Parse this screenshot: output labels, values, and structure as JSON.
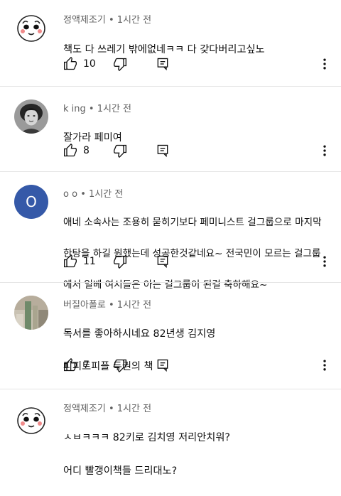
{
  "comments": [
    {
      "author": "정액제조기",
      "time": "1시간 전",
      "lines": [
        "책도 다 쓰레기 밖에없네ㅋㅋ 다 갖다버리고싶노"
      ],
      "likes": "10",
      "avatar": "cartoon"
    },
    {
      "author": "k ing",
      "time": "1시간 전",
      "lines": [
        "잘가라 페미여"
      ],
      "likes": "8",
      "avatar": "photo-woman"
    },
    {
      "author": "o o",
      "time": "1시간 전",
      "lines": [
        "애네 소속사는 조용히 묻히기보다 페미니스트 걸그룹으로 마지막",
        "한탕을 하길 원했는데 성공한것같네요~ 전국민이 모르는 걸그룹",
        "에서 일베 여시들은 아는 걸그룹이 된걸 축하해요~"
      ],
      "likes": "11",
      "avatar": "letter",
      "avatar_letter": "O"
    },
    {
      "author": "버질아폴로",
      "time": "1시간 전",
      "lines": [
        "독서를 좋아하시네요 82년생 김지영",
        "피피트피플 두권의 책"
      ],
      "likes": "7",
      "avatar": "photo-room"
    },
    {
      "author": "정액제조기",
      "time": "1시간 전",
      "lines": [
        "ㅅㅂㅋㅋㅋ 82키로 김치영 저리안치워?",
        "어디 빨갱이책들 드리대노?"
      ],
      "likes": "",
      "avatar": "cartoon"
    }
  ],
  "meta_separator": "•",
  "colors": {
    "accent_avatar": "#3559a8",
    "divider": "#e5e5e5",
    "meta": "#606060"
  },
  "icons": [
    "thumbs-up-icon",
    "thumbs-down-icon",
    "reply-icon",
    "more-vert-icon"
  ]
}
